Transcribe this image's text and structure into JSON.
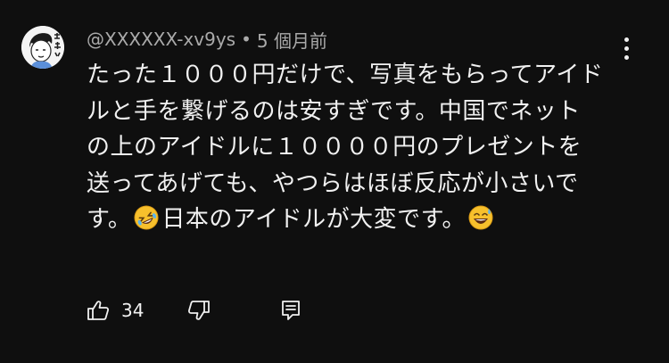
{
  "comment": {
    "username": "@XXXXXX-xv9ys",
    "separator": "•",
    "time_ago": "5 個月前",
    "avatar": {
      "text": "完美"
    },
    "text_part1": "たった１０００円だけで、写真をもらってアイドルと手を繋げるのは安すぎです。中国でネットの上のアイドルに１００００円のプレゼントを送ってあげても、やつらはほぼ反応が小さいです。",
    "emoji1": "rolling-on-floor-laughing",
    "text_part2": "日本のアイドルが大変です。",
    "emoji2": "grinning-sweat"
  },
  "actions": {
    "like_count": "34",
    "like_icon": "thumbs-up-icon",
    "dislike_icon": "thumbs-down-icon",
    "reply_icon": "reply-icon",
    "more_icon": "more-vertical-icon"
  },
  "colors": {
    "background": "#0f0f0f",
    "text": "#f1f1f1",
    "meta": "#aaaaaa"
  }
}
